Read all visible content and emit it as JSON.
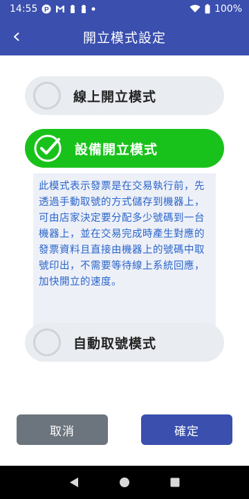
{
  "status_bar": {
    "time": "14:55",
    "battery": "100%",
    "left_icons": [
      "app-p-icon",
      "gmail-icon",
      "security-icon",
      "security-icon",
      "dot-icon"
    ],
    "right_icons": [
      "wifi-icon",
      "battery-icon"
    ]
  },
  "app_bar": {
    "title": "開立模式設定",
    "background_color": "#3a4fae"
  },
  "options": [
    {
      "label": "線上開立模式",
      "selected": false
    },
    {
      "label": "設備開立模式",
      "selected": true
    },
    {
      "label": "自動取號模式",
      "selected": false
    }
  ],
  "description": "此模式表示發票是在交易執行前，先透過手動取號的方式儲存到機器上，可由店家決定要分配多少號碼到一台機器上，並在交易完成時產生對應的發票資料且直接由機器上的號碼中取號印出，不需要等待線上系統回應，加快開立的速度。",
  "buttons": {
    "cancel": "取消",
    "confirm": "確定"
  },
  "colors": {
    "selected_option": "#19c21b",
    "description_text": "#2a66c9",
    "cancel_button": "#6c757d",
    "confirm_button": "#3a4fae"
  },
  "nav_bar": {
    "icons": [
      "back-triangle-icon",
      "home-circle-icon",
      "recents-square-icon"
    ]
  }
}
